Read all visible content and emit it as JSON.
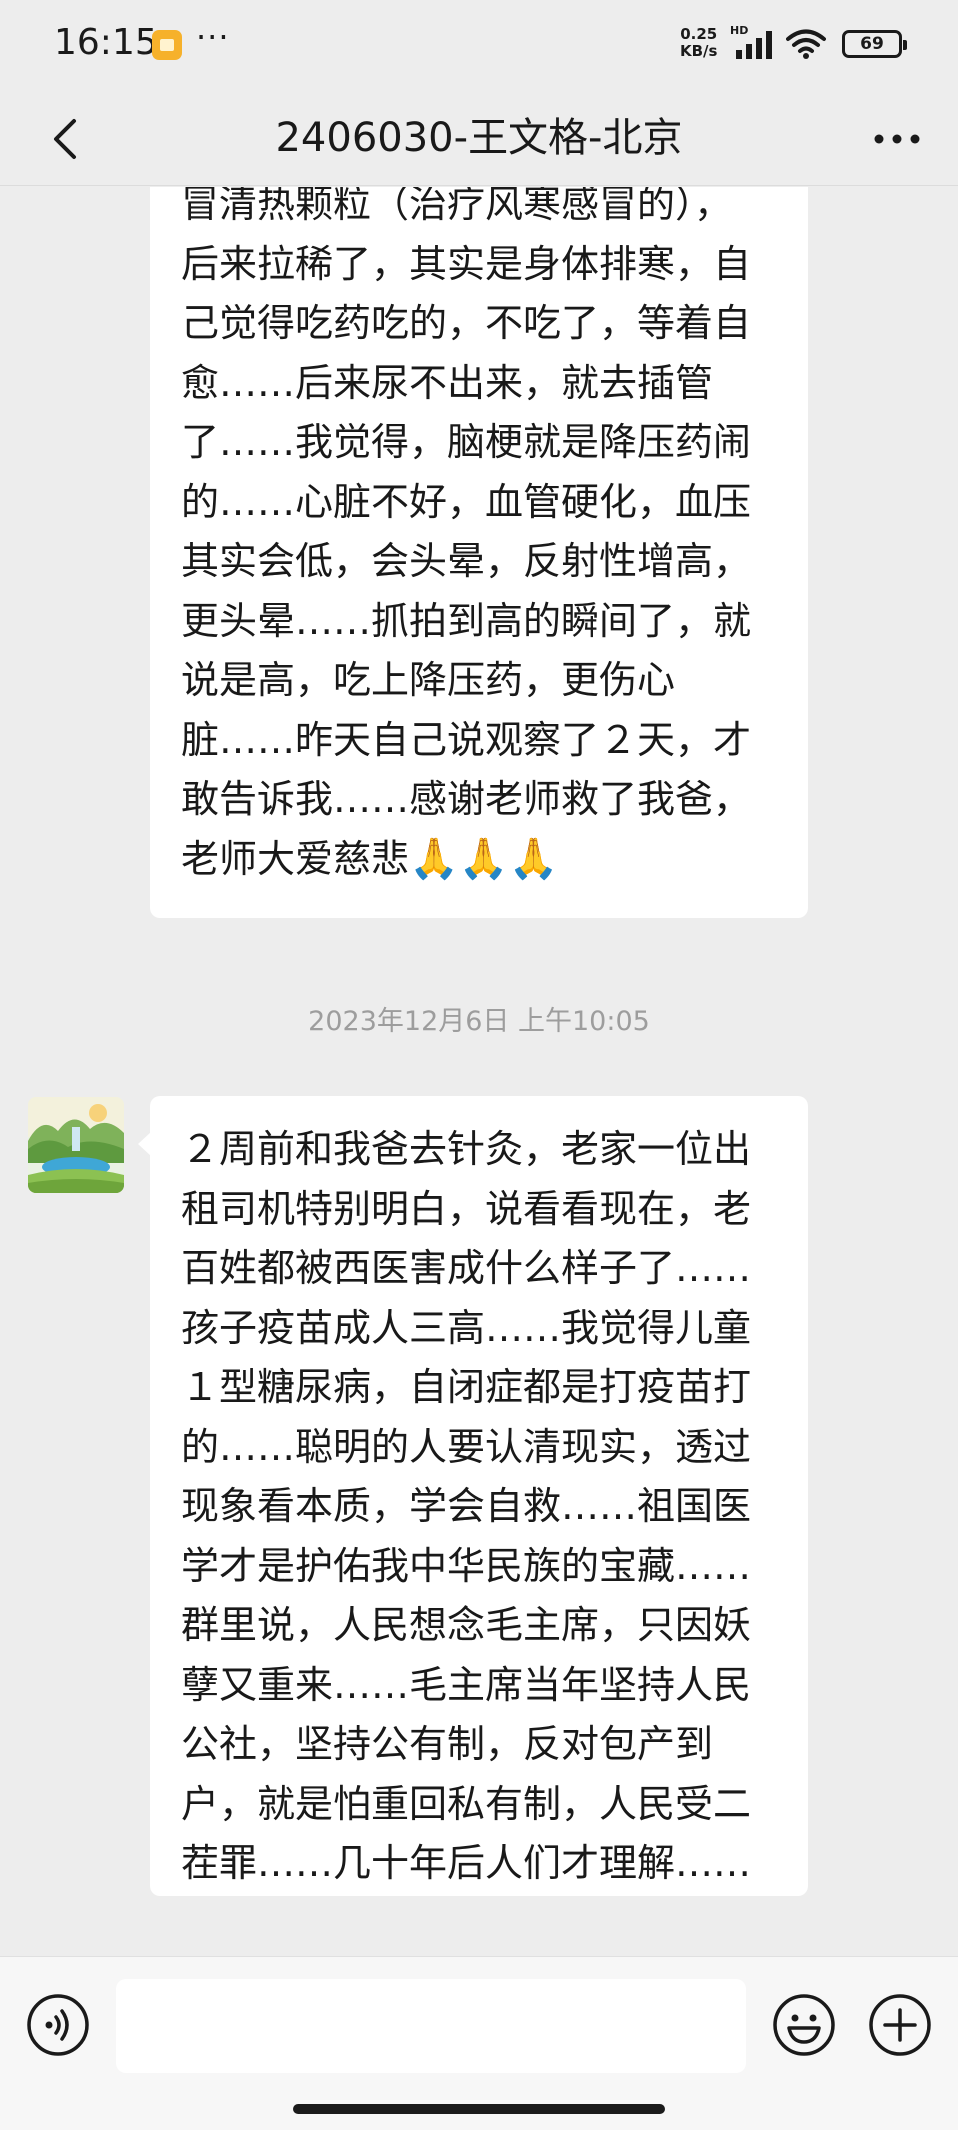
{
  "status_bar": {
    "time": "16:15",
    "more": "···",
    "net_speed_value": "0.25",
    "net_speed_unit": "KB/s",
    "network_type": "HD",
    "battery": "69"
  },
  "header": {
    "title": "2406030-王文格-北京"
  },
  "messages": [
    {
      "lines": [
        "冒清热颗粒（治疗风寒感冒的），",
        "后来拉稀了，其实是身体排寒，自",
        "己觉得吃药吃的，不吃了，等着自",
        "愈……后来尿不出来，就去插管",
        "了……我觉得，脑梗就是降压药闹",
        "的……心脏不好，血管硬化，血压",
        "其实会低，会头晕，反射性增高，",
        "更头晕……抓拍到高的瞬间了，就",
        "说是高，吃上降压药，更伤心",
        "脏……昨天自己说观察了２天，才",
        "敢告诉我……感谢老师救了我爸，"
      ],
      "last_line": "老师大爱慈悲",
      "emojis": "🙏🙏🙏"
    },
    {
      "timestamp": "2023年12月6日 上午10:05",
      "lines": [
        "２周前和我爸去针灸，老家一位出",
        "租司机特别明白，说看看现在，老",
        "百姓都被西医害成什么样子了……",
        "孩子疫苗成人三高……我觉得儿童",
        "１型糖尿病，自闭症都是打疫苗打",
        "的……聪明的人要认清现实，透过",
        "现象看本质，学会自救……祖国医",
        "学才是护佑我中华民族的宝藏……",
        "群里说，人民想念毛主席，只因妖",
        "孽又重来……毛主席当年坚持人民",
        "公社，坚持公有制，反对包产到",
        "户，就是怕重回私有制，人民受二",
        "茬罪……几十年后人们才理解……"
      ]
    }
  ],
  "input": {
    "value": "",
    "placeholder": ""
  },
  "icons": {
    "back": "chevron-left-icon",
    "more": "more-dots-icon",
    "voice": "voice-icon",
    "emoji": "emoji-icon",
    "plus": "plus-icon"
  },
  "colors": {
    "background": "#ededed",
    "bubble": "#ffffff",
    "timestamp": "#9d9d9d"
  }
}
